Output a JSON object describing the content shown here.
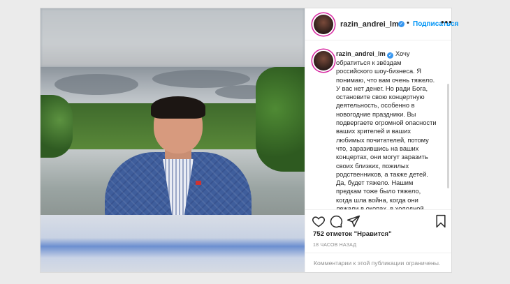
{
  "header": {
    "username": "razin_andrei_lm",
    "dot": "•",
    "follow_label": "Подписаться",
    "more_icon": "•••"
  },
  "caption": {
    "username": "razin_andrei_lm",
    "text": "Хочу обратиться к звёздам российского шоу-бизнеса. Я понимаю, что вам очень тяжело. У вас нет денег. Но ради Бога, остановите свою концертную деятельность, особенно в новогодние праздники. Вы подвергаете огромной опасности ваших зрителей и ваших любимых почитателей, потому что, заразившись на ваших концертах, они могут заразить своих близких, пожилых родственников, а также детей. Да, будет тяжело. Нашим предкам тоже было тяжело, когда шла война, когда они лежали в окопах, в холодной земле, когда не было ни тепла, ни еды. Но люди шли на эти лишения и терпели только для того, чтобы была победа."
  },
  "stats": {
    "likes": "752 отметок \"Нравится\"",
    "time": "18 ЧАСОВ НАЗАД"
  },
  "comments": {
    "notice": "Комментарии к этой публикации ограничены."
  },
  "icons": [
    "heart-icon",
    "comment-icon",
    "share-icon",
    "bookmark-icon",
    "verified-icon",
    "more-icon"
  ],
  "colors": {
    "accent": "#0095f6",
    "verified": "#3897f0",
    "text": "#262626",
    "muted": "#8e8e8e"
  }
}
